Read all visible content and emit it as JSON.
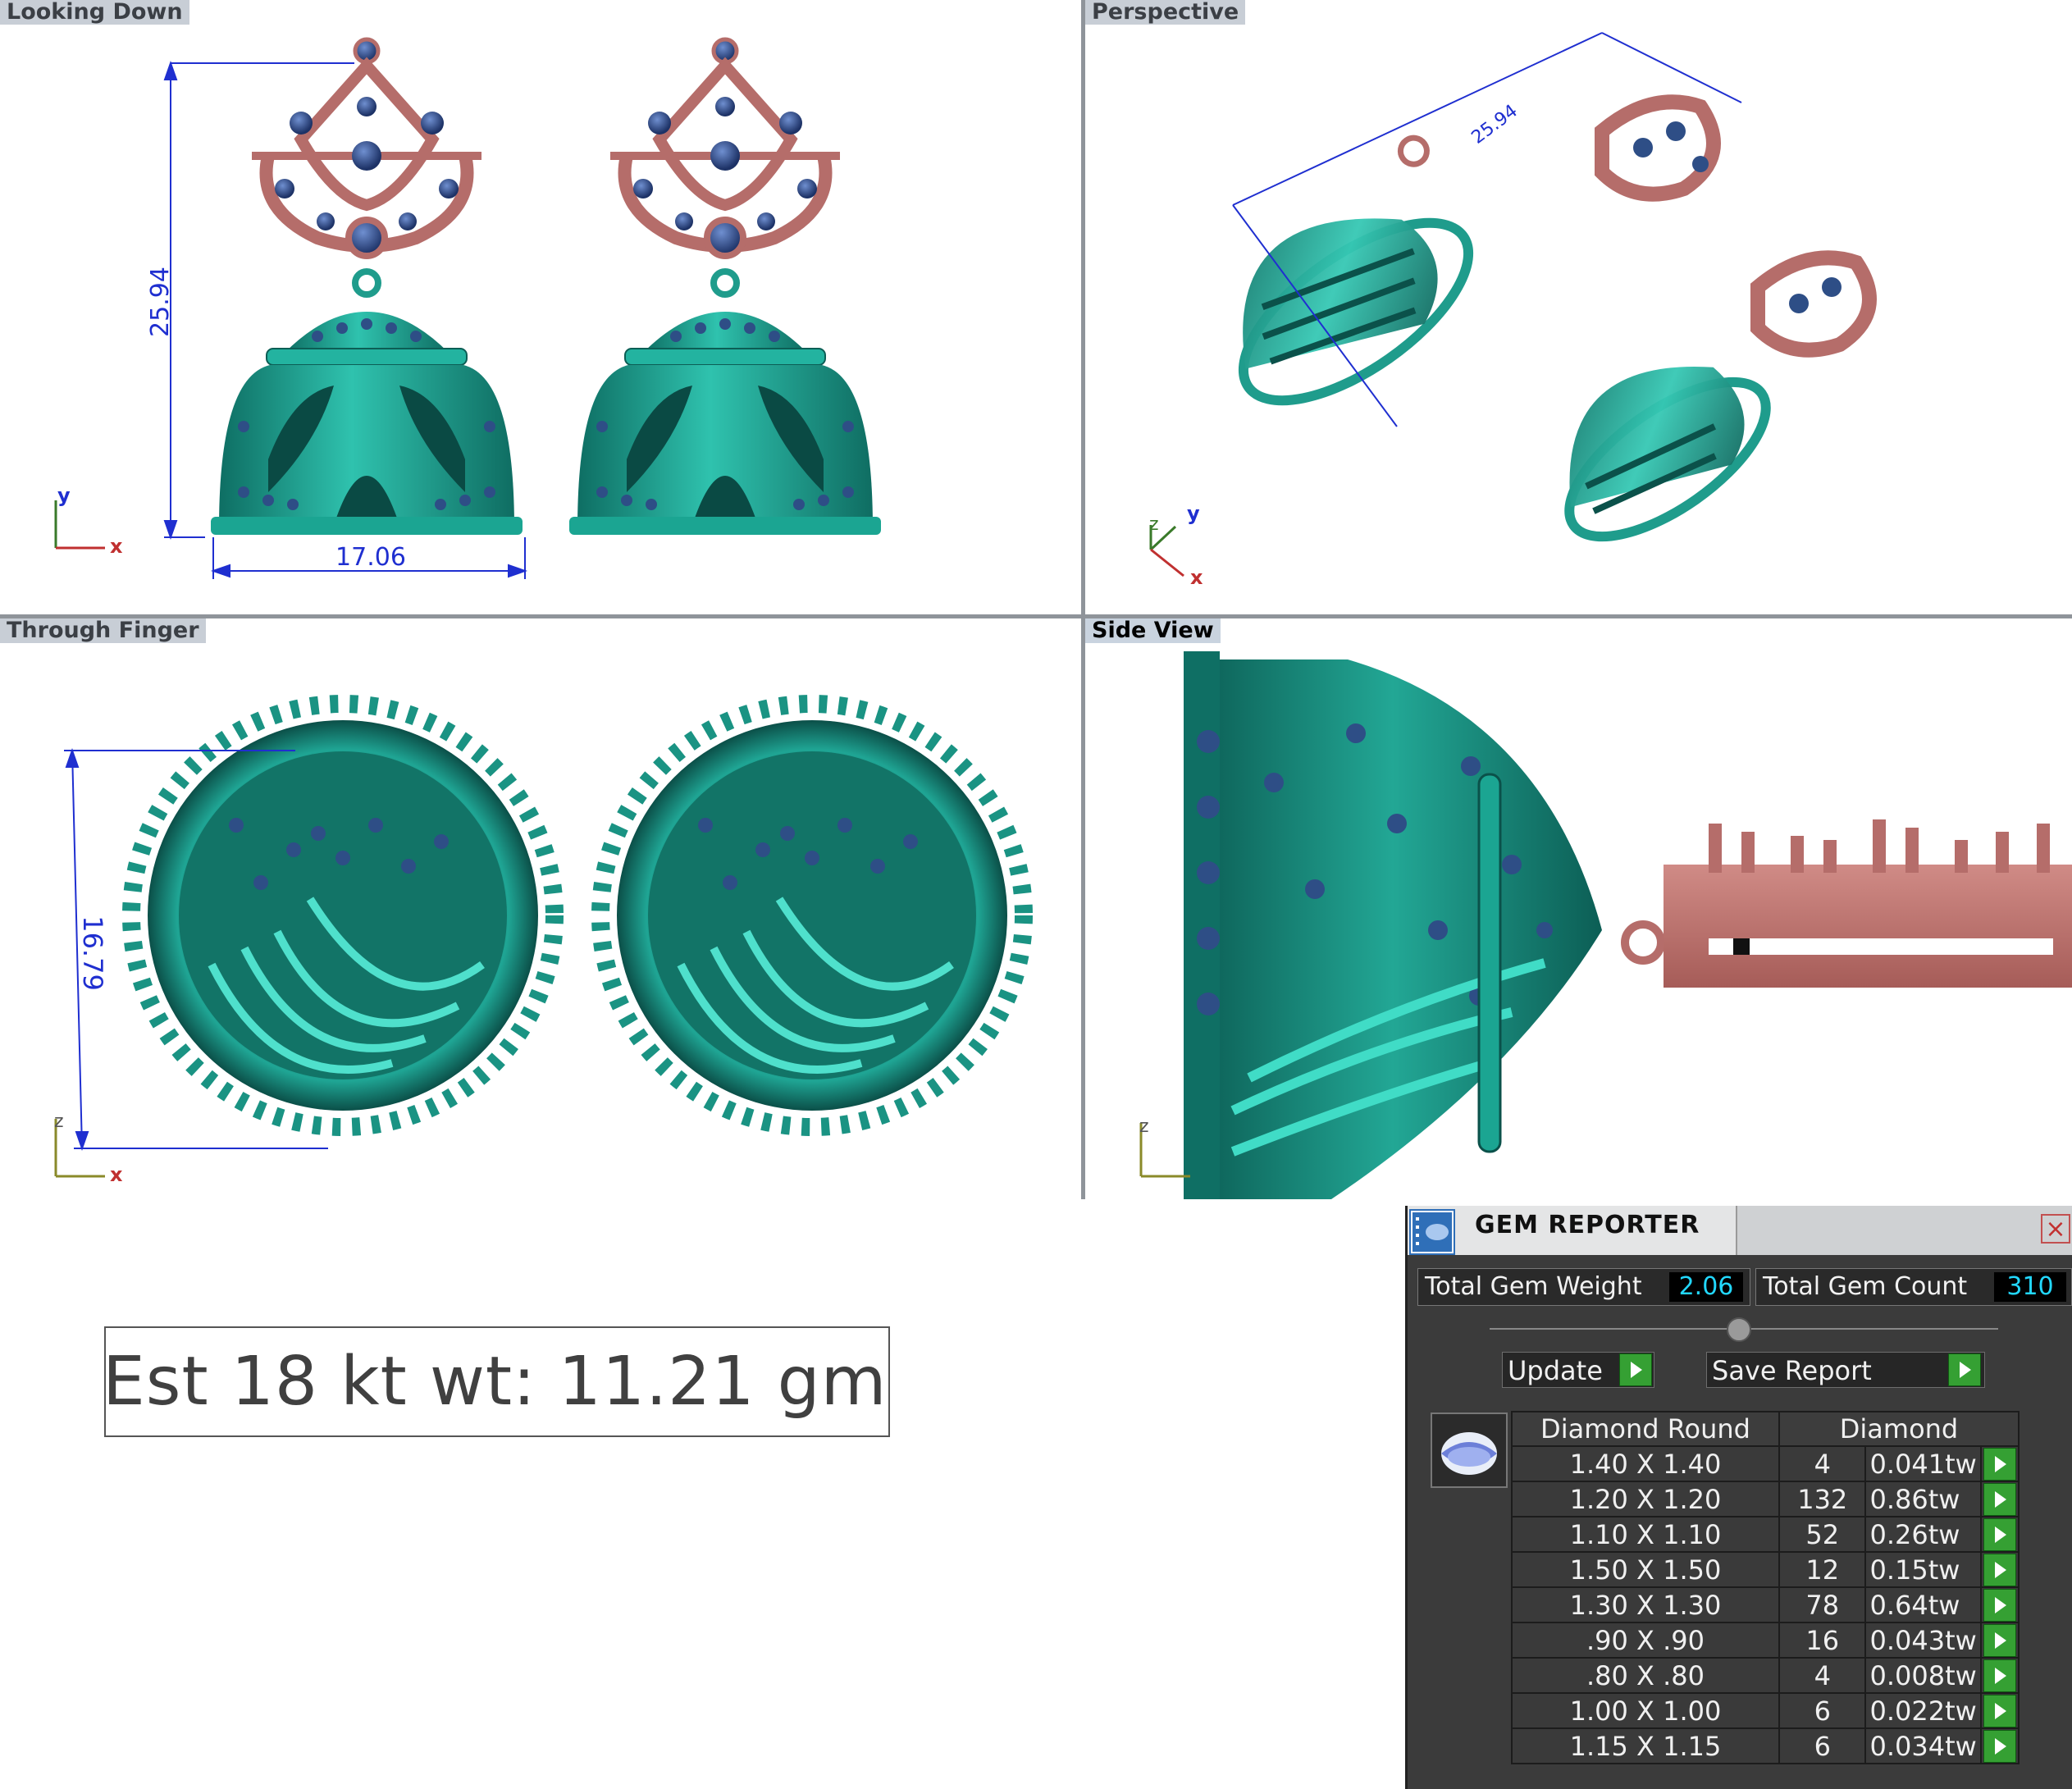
{
  "viewports": {
    "top_left": {
      "label": "Looking Down",
      "dimension_height": "25.94",
      "dimension_width": "17.06",
      "axis_y": "y",
      "axis_x": "x"
    },
    "top_right": {
      "label": "Perspective",
      "dimension": "25.94",
      "axis_z": "z",
      "axis_y": "y",
      "axis_x": "x"
    },
    "bottom_left": {
      "label": "Through Finger",
      "dimension_height": "16.79",
      "axis_z": "z",
      "axis_x": "x"
    },
    "bottom_right": {
      "label": "Side View",
      "axis_z": "z"
    }
  },
  "weight_note": "Est 18 kt wt: 11.21 gm",
  "gem_reporter": {
    "title": "GEM REPORTER",
    "close_symbol": "×",
    "total_weight_label": "Total Gem Weight",
    "total_weight_value": "2.06",
    "total_count_label": "Total Gem Count",
    "total_count_value": "310",
    "update_label": "Update",
    "save_label": "Save Report",
    "table": {
      "col_shape": "Diamond Round",
      "col_material": "Diamond",
      "rows": [
        {
          "size": "1.40 X 1.40",
          "count": "4",
          "weight": "0.041tw"
        },
        {
          "size": "1.20 X 1.20",
          "count": "132",
          "weight": "0.86tw"
        },
        {
          "size": "1.10 X 1.10",
          "count": "52",
          "weight": "0.26tw"
        },
        {
          "size": "1.50 X 1.50",
          "count": "12",
          "weight": "0.15tw"
        },
        {
          "size": "1.30 X 1.30",
          "count": "78",
          "weight": "0.64tw"
        },
        {
          "size": ".90 X .90",
          "count": "16",
          "weight": "0.043tw"
        },
        {
          "size": ".80 X .80",
          "count": "4",
          "weight": "0.008tw"
        },
        {
          "size": "1.00 X 1.00",
          "count": "6",
          "weight": "0.022tw"
        },
        {
          "size": "1.15 X 1.15",
          "count": "6",
          "weight": "0.034tw"
        }
      ]
    }
  },
  "colors": {
    "metal_green": "#1f9c8c",
    "metal_rose": "#b56d6a",
    "gem_blue": "#2e4e86",
    "dimension_blue": "#1f2fd0"
  }
}
